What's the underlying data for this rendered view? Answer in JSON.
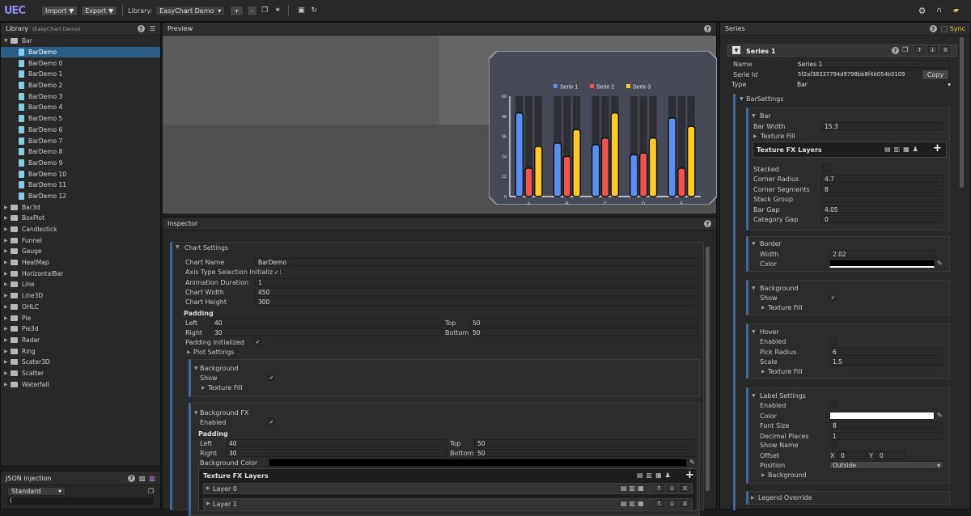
{
  "toolbar": {
    "logo": "UEC",
    "import_label": "Import ▼",
    "export_label": "Export ▼",
    "library_label": "Library:",
    "library_value": "EasyChart Demo"
  },
  "library": {
    "title": "Library",
    "subtitle": "(EasyChart Demo)",
    "groups": [
      "Bar",
      "Bar3d",
      "BoxPlot",
      "Candlestick",
      "Funnel",
      "Gauge",
      "HeatMap",
      "HorizontalBar",
      "Line",
      "Line3D",
      "OHLC",
      "Pie",
      "Pie3d",
      "Radar",
      "Ring",
      "Scater3D",
      "Scatter",
      "Waterfall"
    ],
    "bar_items": [
      "BarDemo",
      "BarDemo 0",
      "BarDemo 1",
      "BarDemo 2",
      "BarDemo 3",
      "BarDemo 4",
      "BarDemo 5",
      "BarDemo 6",
      "BarDemo 7",
      "BarDemo 8",
      "BarDemo 9",
      "BarDemo 10",
      "BarDemo 11",
      "BarDemo 12"
    ]
  },
  "json_injection": {
    "title": "JSON Injection",
    "mode": "Standard",
    "text": "{"
  },
  "preview": {
    "title": "Preview"
  },
  "chart_data": {
    "type": "bar",
    "categories": [
      "A",
      "B",
      "C",
      "D",
      "E"
    ],
    "series": [
      {
        "name": "Serie 1",
        "values": [
          50,
          32,
          31,
          25,
          47
        ],
        "color": "#5a8ff0"
      },
      {
        "name": "Serie 2",
        "values": [
          17,
          24,
          35,
          26,
          17
        ],
        "color": "#ef5350"
      },
      {
        "name": "Serie 3",
        "values": [
          30,
          40,
          50,
          35,
          42
        ],
        "color": "#ffca28"
      }
    ],
    "ylim": [
      0,
      60
    ],
    "yticks": [
      "60",
      "48",
      "36",
      "24",
      "12",
      "0"
    ],
    "legend": "top-center",
    "background_color": "#434654"
  },
  "inspector": {
    "title": "Inspector",
    "chart_settings": "Chart Settings",
    "fields": {
      "chart_name_l": "Chart Name",
      "chart_name_v": "BarDemo",
      "axis_type_l": "Axis Type Selection Initialized",
      "anim_l": "Animation Duration",
      "anim_v": "1",
      "width_l": "Chart Width",
      "width_v": "450",
      "height_l": "Chart Height",
      "height_v": "300",
      "padding_l": "Padding",
      "left_l": "Left",
      "left_v": "40",
      "top_l": "Top",
      "top_v": "50",
      "right_l": "Right",
      "right_v": "30",
      "bottom_l": "Bottom",
      "bottom_v": "50",
      "pad_init_l": "Padding Initialized",
      "plot_l": "Plot Settings",
      "bg_l": "Background",
      "show_l": "Show",
      "tex_l": "Texture Fill",
      "bgfx_l": "Background FX",
      "enabled_l": "Enabled",
      "bgfx_padding_l": "Padding",
      "fx_left_l": "Left",
      "fx_left_v": "40",
      "fx_top_l": "Top",
      "fx_top_v": "50",
      "fx_right_l": "Right",
      "fx_right_v": "30",
      "fx_bottom_l": "Bottom",
      "fx_bottom_v": "50",
      "bgcolor_l": "Background Color",
      "tfx_l": "Texture FX Layers",
      "layer0": "Layer 0",
      "layer1": "Layer 1"
    }
  },
  "series_panel": {
    "title": "Series",
    "sync_label": "Sync",
    "series_name": "Series 1",
    "name_l": "Name",
    "name_v": "Series 1",
    "id_l": "Serie Id",
    "id_v": "5f2af38337794d9798bb8f4b054b0109",
    "copy_label": "Copy",
    "type_l": "Type",
    "type_v": "Bar",
    "bar_settings": "BarSettings",
    "bar_l": "Bar",
    "bar_width_l": "Bar Width",
    "bar_width_v": "15.3",
    "texture_fill_l": "Texture Fill",
    "tfx_l": "Texture FX Layers",
    "stacked_l": "Stacked",
    "corner_r_l": "Corner Radius",
    "corner_r_v": "4.7",
    "corner_s_l": "Corner Segments",
    "corner_s_v": "8",
    "stack_g_l": "Stack Group",
    "stack_g_v": "",
    "bar_gap_l": "Bar Gap",
    "bar_gap_v": "4.05",
    "cat_gap_l": "Category Gap",
    "cat_gap_v": "0",
    "border_l": "Border",
    "bwidth_l": "Width",
    "bwidth_v": "2.02",
    "bcolor_l": "Color",
    "bg_l": "Background",
    "show_l": "Show",
    "bg_tex_l": "Texture Fill",
    "hover_l": "Hover",
    "h_enabled_l": "Enabled",
    "pick_l": "Pick Radius",
    "pick_v": "6",
    "scale_l": "Scale",
    "scale_v": "1.5",
    "h_tex_l": "Texture Fill",
    "label_l": "Label Settings",
    "l_enabled_l": "Enabled",
    "l_color_l": "Color",
    "font_l": "Font Size",
    "font_v": "8",
    "dec_l": "Decimal Places",
    "dec_v": "1",
    "showname_l": "Show Name",
    "offset_l": "Offset",
    "off_x_l": "X",
    "off_x_v": "0",
    "off_y_l": "Y",
    "off_y_v": "0",
    "position_l": "Position",
    "position_v": "Outside",
    "l_bg_l": "Background",
    "legend_l": "Legend Override"
  }
}
